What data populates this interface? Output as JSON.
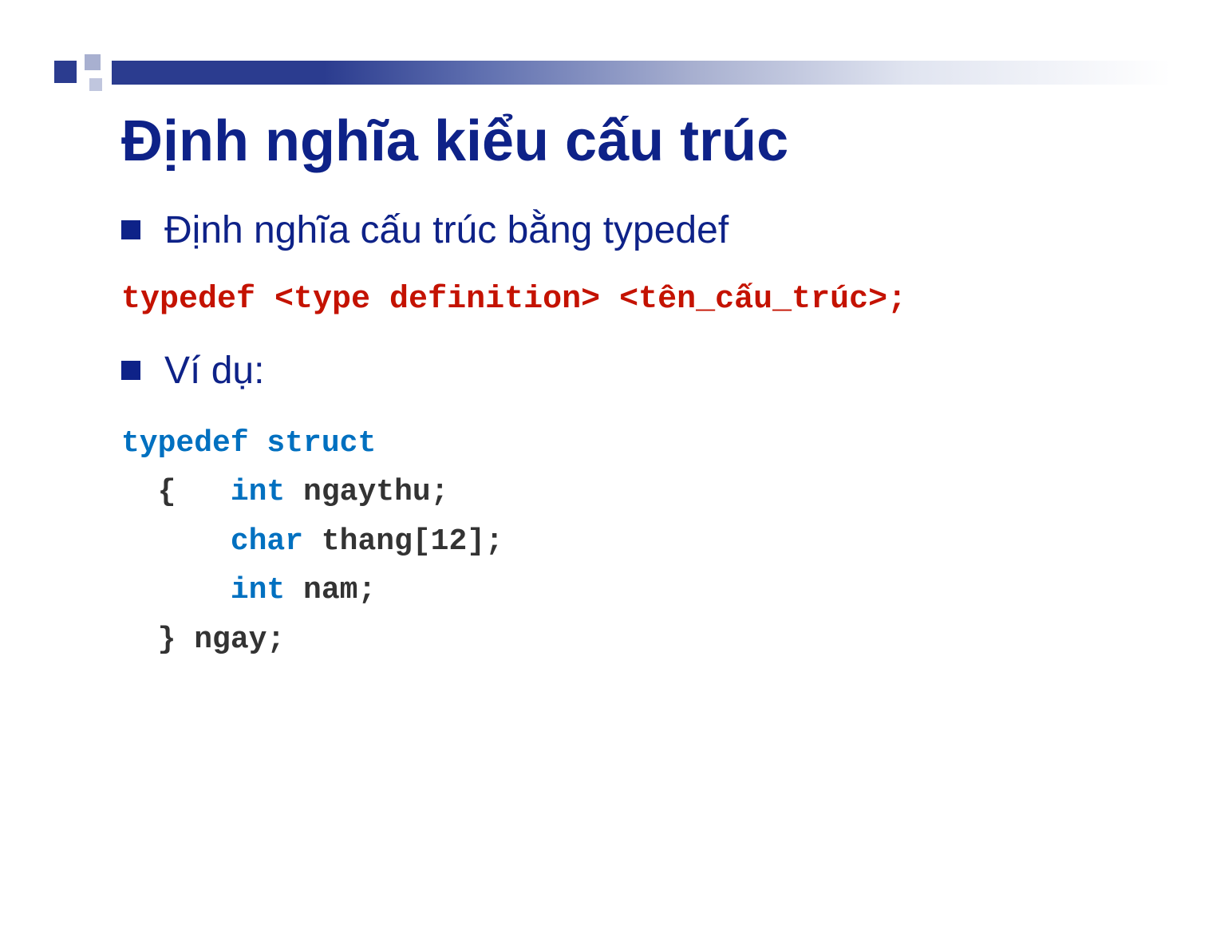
{
  "title": "Định nghĩa kiểu cấu trúc",
  "bullet1": "Định nghĩa cấu trúc bằng typedef",
  "syntax": "typedef <type definition> <tên_cấu_trúc>;",
  "bullet2": "Ví dụ:",
  "code": {
    "line1_kw": "typedef struct",
    "line2_brace": "  {   ",
    "line2_kw": "int",
    "line2_rest": " ngaythu;",
    "line3_pad": "      ",
    "line3_kw": "char",
    "line3_rest": " thang[12];",
    "line4_pad": "      ",
    "line4_kw": "int",
    "line4_rest": " nam;",
    "line5": "  } ngay;"
  }
}
